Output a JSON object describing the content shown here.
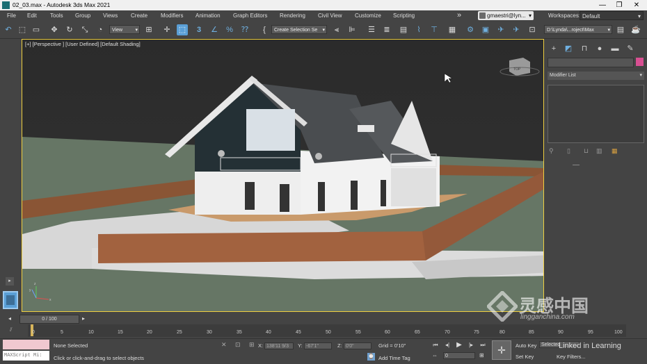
{
  "window": {
    "title": "02_03.max - Autodesk 3ds Max 2021",
    "minimize": "—",
    "maximize": "❐",
    "close": "✕"
  },
  "menu": [
    "File",
    "Edit",
    "Tools",
    "Group",
    "Views",
    "Create",
    "Modifiers",
    "Animation",
    "Graph Editors",
    "Rendering",
    "Civil View",
    "Customize",
    "Scripting"
  ],
  "menu_more": "»",
  "user": {
    "name": "gmaestri@lyn...",
    "dropdown": "▾"
  },
  "workspaces": {
    "label": "Workspaces:",
    "value": "Default"
  },
  "toolbar": {
    "view_combo": "View",
    "selection_set": "Create Selection Se",
    "project_path": "D:\\Lynda\\...roject\\Max",
    "snap_label": "3",
    "percent_icon": "%",
    "angle_icon": "∠"
  },
  "viewport": {
    "label": "[+] [Perspective ] [User Defined] [Default Shading]",
    "viewcube_label": "TOP",
    "axis_x": "x",
    "axis_y": "y",
    "axis_z": "z"
  },
  "command_panel": {
    "modifier_list": "Modifier List"
  },
  "timeline": {
    "frame": "0 / 100",
    "ticks": [
      "0",
      "5",
      "10",
      "15",
      "20",
      "25",
      "30",
      "35",
      "40",
      "45",
      "50",
      "55",
      "60",
      "65",
      "70",
      "75",
      "80",
      "85",
      "90",
      "95",
      "100"
    ]
  },
  "status": {
    "maxscript": "MAXScript Mi:",
    "selection": "None Selected",
    "prompt": "Click or click-and-drag to select objects",
    "x_label": "X:",
    "x_value": "138'11 9/3",
    "y_label": "Y:",
    "y_value": "-67'1\"",
    "z_label": "Z:",
    "z_value": "0'0\"",
    "grid": "Grid = 0'10\"",
    "add_time_tag": "Add Time Tag",
    "auto_key": "Auto Key",
    "set_key": "Set Key",
    "selected": "Selected",
    "key_filters": "Key Filters...",
    "current_frame": "0"
  },
  "watermark": {
    "brand": "灵感中国",
    "url": "lingganchina.com",
    "linkedin": "Linked in Learning"
  },
  "colors": {
    "accent": "#5a9fd6",
    "viewport_border": "#f0d040",
    "swatch": "#d84f92"
  }
}
